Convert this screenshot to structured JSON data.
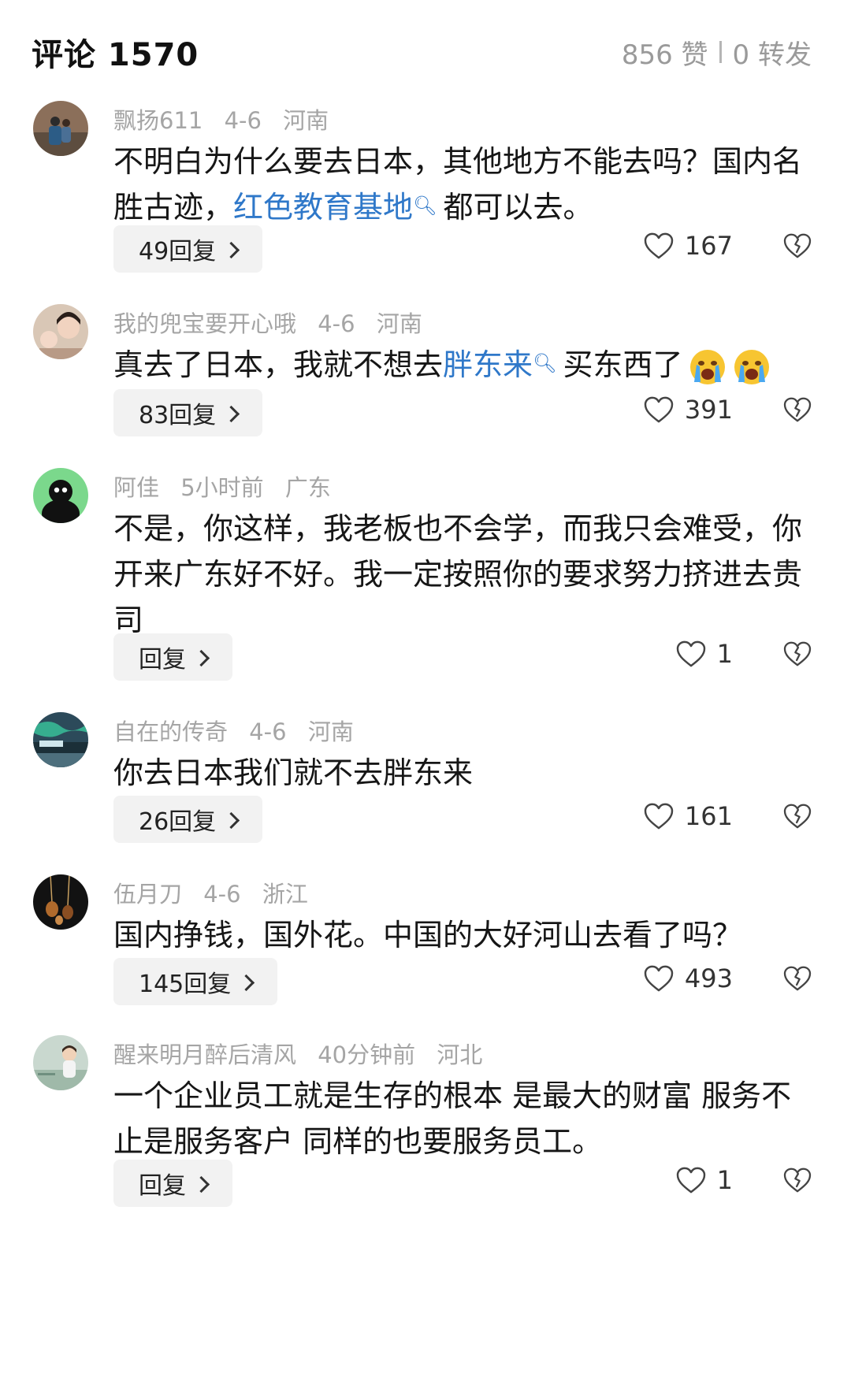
{
  "header": {
    "title": "评论 1570",
    "likes": "856 赞",
    "shares": "0 转发"
  },
  "colors": {
    "link": "#2f78c9",
    "meta": "#a5a5a5",
    "reply_bg": "#f2f2f2"
  },
  "comments": [
    {
      "user": "飘扬611",
      "time": "4-6",
      "region": "河南",
      "text_pre": "不明白为什么要去日本，其他地方不能去吗？国内名胜古迹，",
      "link": "红色教育基地",
      "text_post": "都可以去。",
      "reply_label": "49回复",
      "likes": "167",
      "avatar_icon": "user-avatar-photo"
    },
    {
      "user": "我的兜宝要开心哦",
      "time": "4-6",
      "region": "河南",
      "text_pre": "真去了日本，我就不想去",
      "link": "胖东来",
      "text_post": "买东西了",
      "emoji": "crying-face-emoji",
      "reply_label": "83回复",
      "likes": "391",
      "avatar_icon": "user-avatar-photo"
    },
    {
      "user": "阿佳",
      "time": "5小时前",
      "region": "广东",
      "text": "不是，你这样，我老板也不会学，而我只会难受，你开来广东好不好。我一定按照你的要求努力挤进去贵司",
      "reply_label": "回复",
      "likes": "1",
      "avatar_icon": "cartoon-avatar"
    },
    {
      "user": "自在的传奇",
      "time": "4-6",
      "region": "河南",
      "text": "你去日本我们就不去胖东来",
      "reply_label": "26回复",
      "likes": "161",
      "avatar_icon": "landscape-avatar"
    },
    {
      "user": "伍月刀",
      "time": "4-6",
      "region": "浙江",
      "text": "国内挣钱，国外花。中国的大好河山去看了吗？",
      "reply_label": "145回复",
      "likes": "493",
      "avatar_icon": "jewelry-avatar"
    },
    {
      "user": "醒来明月醉后清风",
      "time": "40分钟前",
      "region": "河北",
      "text": "一个企业员工就是生存的根本 是最大的财富 服务不止是服务客户 同样的也要服务员工。",
      "reply_label": "回复",
      "likes": "1",
      "avatar_icon": "child-avatar"
    }
  ]
}
